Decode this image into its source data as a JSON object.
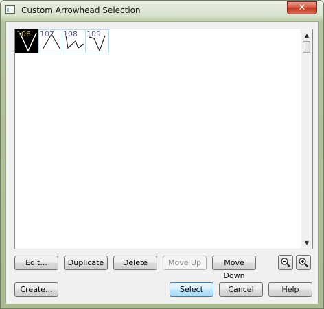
{
  "window": {
    "title": "Custom Arrowhead Selection",
    "close_label": "✕"
  },
  "arrowheads": [
    {
      "number": "106",
      "selected": true
    },
    {
      "number": "107",
      "selected": false
    },
    {
      "number": "108",
      "selected": false
    },
    {
      "number": "109",
      "selected": false
    }
  ],
  "buttons": {
    "edit": "Edit...",
    "duplicate": "Duplicate",
    "delete": "Delete",
    "move_up": "Move Up",
    "move_down": "Move Down",
    "create": "Create...",
    "select": "Select",
    "cancel": "Cancel",
    "help": "Help"
  },
  "icons": {
    "zoom_out": "zoom-out-icon",
    "zoom_in": "zoom-in-icon",
    "scroll_up": "▲",
    "scroll_down": "▼"
  }
}
